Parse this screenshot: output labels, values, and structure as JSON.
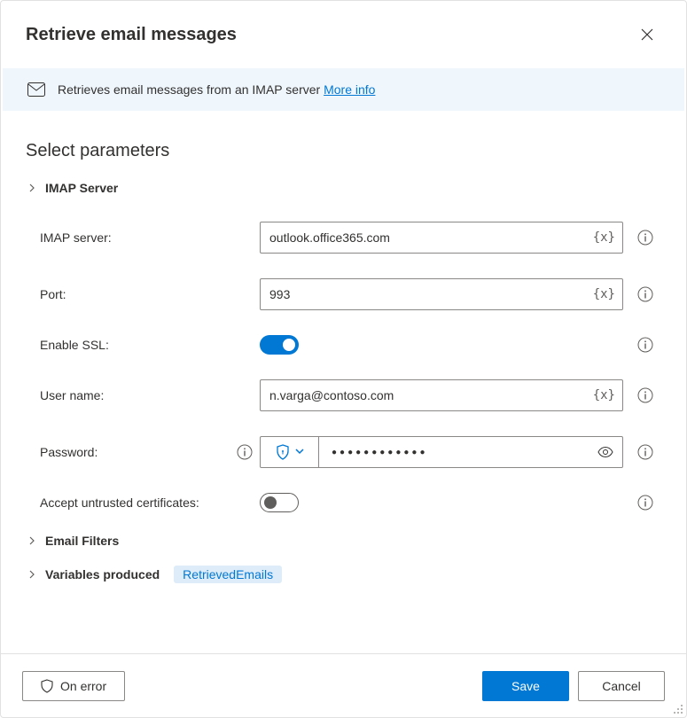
{
  "header": {
    "title": "Retrieve email messages"
  },
  "banner": {
    "text": "Retrieves email messages from an IMAP server ",
    "link": "More info"
  },
  "section_title": "Select parameters",
  "accordions": {
    "imap": "IMAP Server",
    "filters": "Email Filters",
    "variables": "Variables produced"
  },
  "labels": {
    "imap_server": "IMAP server:",
    "port": "Port:",
    "enable_ssl": "Enable SSL:",
    "user_name": "User name:",
    "password": "Password:",
    "accept_untrusted": "Accept untrusted certificates:"
  },
  "values": {
    "imap_server": "outlook.office365.com",
    "port": "993",
    "user_name": "n.varga@contoso.com",
    "password_dots": "●●●●●●●●●●●●",
    "enable_ssl": true,
    "accept_untrusted": false
  },
  "var_token": "{x}",
  "variables_chip": "RetrievedEmails",
  "footer": {
    "on_error": "On error",
    "save": "Save",
    "cancel": "Cancel"
  }
}
